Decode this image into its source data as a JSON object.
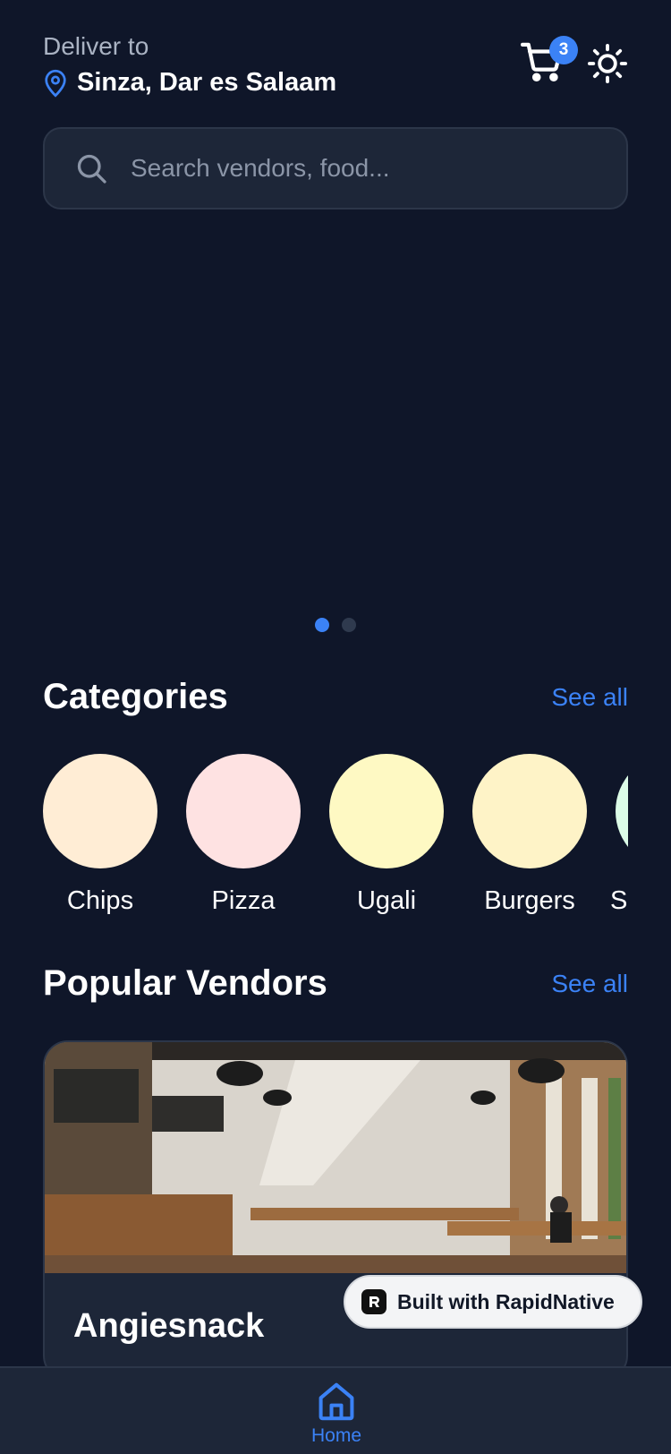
{
  "header": {
    "deliver_label": "Deliver to",
    "location": "Sinza, Dar es Salaam",
    "cart_count": "3"
  },
  "search": {
    "placeholder": "Search vendors, food..."
  },
  "banner": {
    "slides_total": 2,
    "active_slide": 1
  },
  "categories": {
    "title": "Categories",
    "see_all": "See all",
    "items": [
      {
        "label": "Chips",
        "color": "#ffedd5"
      },
      {
        "label": "Pizza",
        "color": "#fee2e2"
      },
      {
        "label": "Ugali",
        "color": "#fef9c3"
      },
      {
        "label": "Burgers",
        "color": "#fef3c7"
      },
      {
        "label": "S",
        "color": "#dcfce7"
      }
    ]
  },
  "vendors": {
    "title": "Popular Vendors",
    "see_all": "See all",
    "items": [
      {
        "name": "Angiesnack"
      }
    ]
  },
  "badge": {
    "text": "Built with RapidNative"
  },
  "nav": {
    "home_label": "Home"
  },
  "colors": {
    "accent": "#3b82f6",
    "background": "#0f1629",
    "surface": "#1d2638"
  }
}
